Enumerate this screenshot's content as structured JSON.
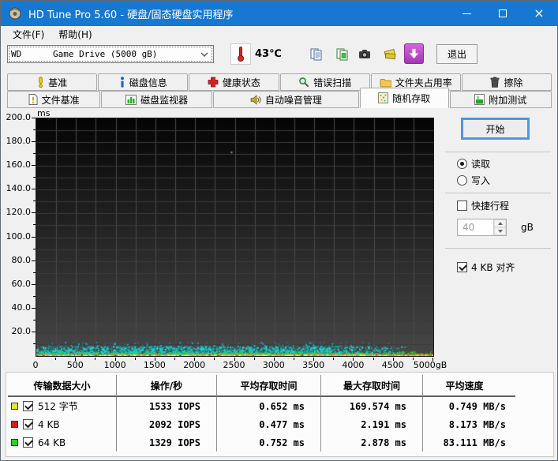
{
  "window": {
    "title": "HD Tune Pro 5.60 - 硬盘/固态硬盘实用程序"
  },
  "menu": {
    "file": "文件(F)",
    "help": "帮助(H)"
  },
  "toolbar": {
    "drive_selector": "WD      Game Drive (5000 gB)",
    "temperature": "43℃",
    "exit_label": "退出",
    "icons": [
      "copy-text-icon",
      "copy-image-icon",
      "screenshot-icon",
      "save-icon",
      "update-icon"
    ]
  },
  "tabs": {
    "active": "随机存取",
    "row1": [
      {
        "label": "基准",
        "icon": "benchmark-icon"
      },
      {
        "label": "磁盘信息",
        "icon": "disk-info-icon"
      },
      {
        "label": "健康状态",
        "icon": "health-icon"
      },
      {
        "label": "错误扫描",
        "icon": "error-scan-icon"
      },
      {
        "label": "文件夹占用率",
        "icon": "folder-usage-icon"
      },
      {
        "label": "擦除",
        "icon": "erase-icon"
      }
    ],
    "row2": [
      {
        "label": "文件基准",
        "icon": "file-benchmark-icon"
      },
      {
        "label": "磁盘监视器",
        "icon": "disk-monitor-icon"
      },
      {
        "label": "自动噪音管理",
        "icon": "aam-icon"
      },
      {
        "label": "随机存取",
        "icon": "random-access-icon"
      },
      {
        "label": "附加测试",
        "icon": "extra-tests-icon"
      }
    ]
  },
  "panel": {
    "start_label": "开始",
    "read_label": "读取",
    "write_label": "写入",
    "short_stroke_label": "快捷行程",
    "short_stroke_value": "40",
    "short_stroke_unit": "gB",
    "align_label": "4 KB 对齐"
  },
  "results_table": {
    "headers": [
      "传输数据大小",
      "操作/秒",
      "平均存取时间",
      "最大存取时间",
      "平均速度"
    ],
    "rows": [
      {
        "swatch": "#e6e432",
        "label": "512 字节",
        "ops": "1533 IOPS",
        "avg_time": "0.652 ms",
        "max_time": "169.574 ms",
        "avg_speed": "0.749 MB/s"
      },
      {
        "swatch": "#cf1d1d",
        "label": "4 KB",
        "ops": "2092 IOPS",
        "avg_time": "0.477 ms",
        "max_time": "2.191 ms",
        "avg_speed": "8.173 MB/s"
      },
      {
        "swatch": "#2fce2f",
        "label": "64 KB",
        "ops": "1329 IOPS",
        "avg_time": "0.752 ms",
        "max_time": "2.878 ms",
        "avg_speed": "83.111 MB/s"
      }
    ]
  },
  "chart_data": {
    "type": "scatter",
    "title": "随机存取测试 (access time vs disk position)",
    "y_unit": "ms",
    "x_unit": "gB",
    "xlim": [
      0,
      5000
    ],
    "ylim": [
      0,
      200
    ],
    "x_ticks": [
      0,
      500,
      1000,
      1500,
      2000,
      2500,
      3000,
      3500,
      4000,
      4500,
      5000
    ],
    "y_ticks": [
      20,
      40,
      60,
      80,
      100,
      120,
      140,
      160,
      180,
      200
    ],
    "grid": {
      "x_minor": 250,
      "y_minor": 10,
      "background": "black-gradient"
    },
    "series": [
      {
        "name": "512 字节",
        "color": "#e6e432",
        "avg_ms": 0.652,
        "max_ms": 169.574,
        "iops": 1533,
        "speed_mbs": 0.749
      },
      {
        "name": "4 KB",
        "color": "#cf1d1d",
        "avg_ms": 0.477,
        "max_ms": 2.191,
        "iops": 2092,
        "speed_mbs": 8.173
      },
      {
        "name": "64 KB",
        "color": "#2fce2f",
        "avg_ms": 0.752,
        "max_ms": 2.878,
        "iops": 1329,
        "speed_mbs": 83.111
      }
    ],
    "scatter_bands": [
      {
        "color": "#19dcdc",
        "count": 2400,
        "x": [
          0,
          4650
        ],
        "y": [
          1.6,
          8.5
        ],
        "taper_from": 3600
      },
      {
        "color": "#0fb0c4",
        "count": 500,
        "x": [
          0,
          4650
        ],
        "y": [
          2.5,
          12.0
        ],
        "taper_from": 3400
      },
      {
        "color": "#2fce2f",
        "count": 520,
        "x": [
          0,
          5000
        ],
        "y": [
          1.2,
          4.2
        ]
      },
      {
        "color": "#e6e432",
        "count": 1300,
        "x": [
          0,
          5000
        ],
        "y": [
          0.5,
          1.5
        ]
      },
      {
        "color": "#d98f2b",
        "count": 350,
        "x": [
          0,
          5000
        ],
        "y": [
          0.9,
          2.4
        ]
      },
      {
        "color": "#cf1d1d",
        "count": 90,
        "x": [
          0,
          5000
        ],
        "y": [
          0.4,
          1.4
        ]
      }
    ],
    "outliers": [
      {
        "color": "#9a9a9a",
        "x": 2450,
        "y": 172
      }
    ]
  }
}
